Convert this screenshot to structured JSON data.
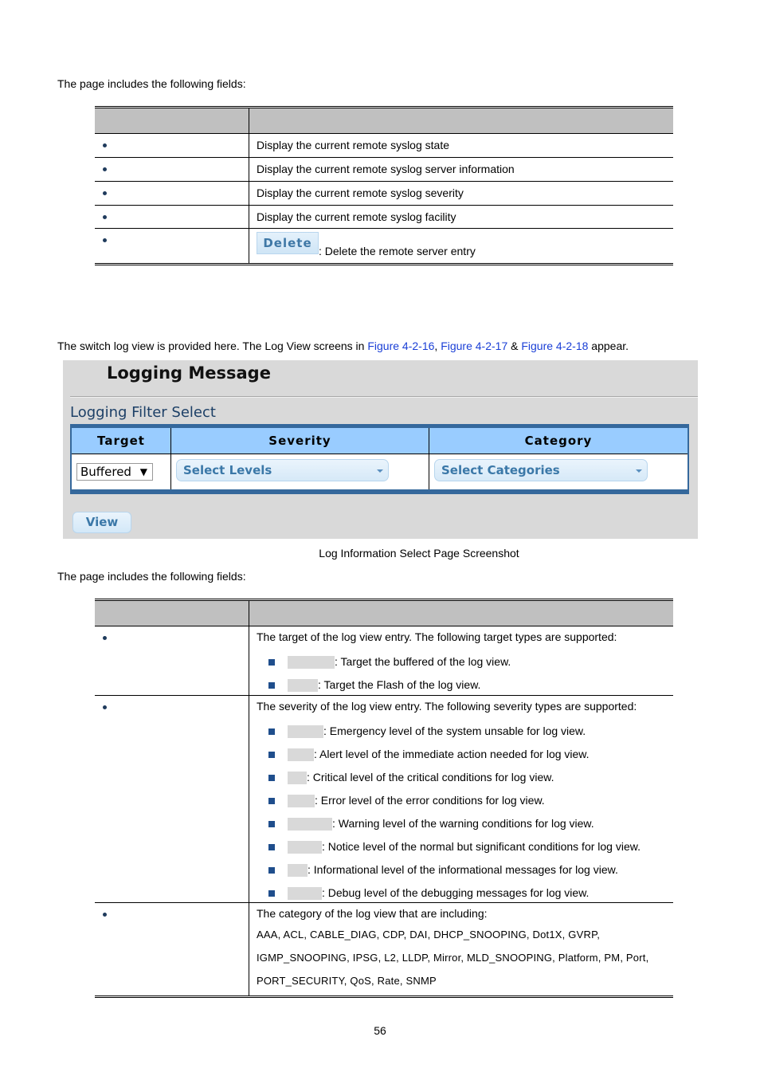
{
  "intro1": "The page includes the following fields:",
  "table1": {
    "rows": [
      {
        "description": "Display the current remote syslog state"
      },
      {
        "description": "Display the current remote syslog server information"
      },
      {
        "description": "Display the current remote syslog severity"
      },
      {
        "description": "Display the current remote syslog facility"
      },
      {
        "button_label": "Delete",
        "description": ": Delete the remote server entry"
      }
    ]
  },
  "intro2": {
    "before": "The switch log view is provided here. The Log View screens in ",
    "link1": "Figure 4-2-16",
    "sep1": ", ",
    "link2": "Figure 4-2-17",
    "sep2": " & ",
    "link3": "Figure 4-2-18",
    "after": " appear."
  },
  "screenshot": {
    "title": "Logging Message",
    "subtitle": "Logging Filter Select",
    "headers": {
      "target": "Target",
      "severity": "Severity",
      "category": "Category"
    },
    "target_value": "Buffered",
    "target_arrow": "▼",
    "severity_placeholder": "Select Levels",
    "category_placeholder": "Select Categories",
    "view_button": "View"
  },
  "caption": "Log Information Select Page Screenshot",
  "intro3": "The page includes the following fields:",
  "table2": {
    "target": {
      "description": "The target of the log view entry. The following target types are supported:",
      "items": [
        ": Target the buffered of the log view.",
        ": Target the Flash of the log view."
      ]
    },
    "severity": {
      "description": "The severity of the log view entry. The following severity types are supported:",
      "items": [
        ": Emergency level of the system unsable for log view.",
        ": Alert level of the immediate action needed for log view.",
        ": Critical level of the critical conditions for log view.",
        ": Error level of the error conditions for log view.",
        ": Warning level of the warning conditions for log view.",
        ": Notice level of the normal but significant conditions for log view.",
        ": Informational level of the informational messages for log view.",
        ": Debug level of the debugging messages for log view."
      ]
    },
    "category": {
      "description": "The category of the log view that are including:",
      "lines": [
        "AAA, ACL, CABLE_DIAG, CDP, DAI, DHCP_SNOOPING, Dot1X, GVRP,",
        "IGMP_SNOOPING, IPSG, L2, LLDP, Mirror, MLD_SNOOPING, Platform, PM, Port,",
        "PORT_SECURITY, QoS, Rate, SNMP"
      ]
    }
  },
  "page_number": "56"
}
